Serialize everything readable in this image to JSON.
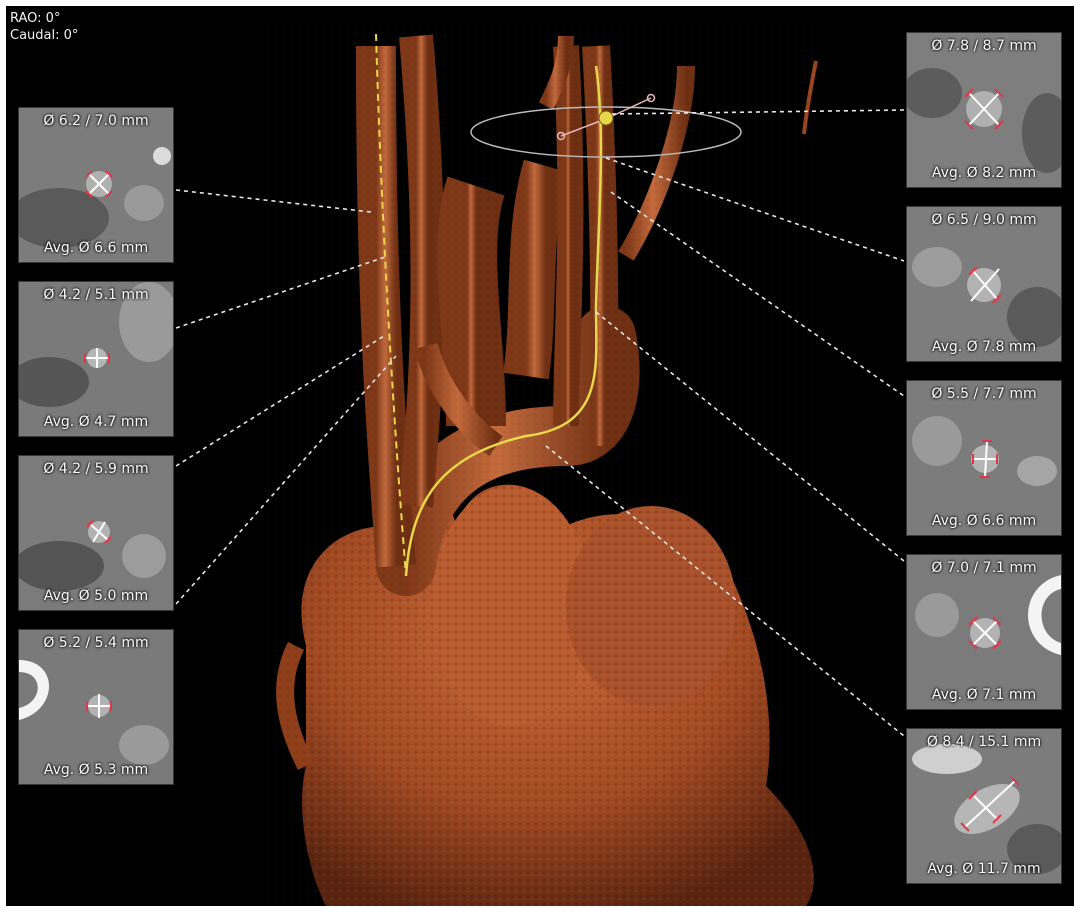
{
  "orientation": {
    "rao": "RAO: 0°",
    "caudal": "Caudal: 0°"
  },
  "colors": {
    "vessel": "#b5532a",
    "centerline": "#e6d84a",
    "crosshair": "#ffffff",
    "endcap": "#e0384a",
    "leader": "#e8e8e8"
  },
  "left_panels": [
    {
      "diameters": "Ø 6.2 / 7.0 mm",
      "average": "Avg. Ø 6.6 mm"
    },
    {
      "diameters": "Ø 4.2 / 5.1 mm",
      "average": "Avg. Ø 4.7 mm"
    },
    {
      "diameters": "Ø 4.2 / 5.9 mm",
      "average": "Avg. Ø 5.0 mm"
    },
    {
      "diameters": "Ø 5.2 / 5.4 mm",
      "average": "Avg. Ø 5.3 mm"
    }
  ],
  "right_panels": [
    {
      "diameters": "Ø 7.8 / 8.7 mm",
      "average": "Avg. Ø 8.2 mm"
    },
    {
      "diameters": "Ø 6.5 / 9.0 mm",
      "average": "Avg. Ø 7.8 mm"
    },
    {
      "diameters": "Ø 5.5 / 7.7 mm",
      "average": "Avg. Ø 6.6 mm"
    },
    {
      "diameters": "Ø 7.0 / 7.1 mm",
      "average": "Avg. Ø 7.1 mm"
    },
    {
      "diameters": "Ø 8.4 / 15.1 mm",
      "average": "Avg. Ø 11.7 mm"
    }
  ]
}
